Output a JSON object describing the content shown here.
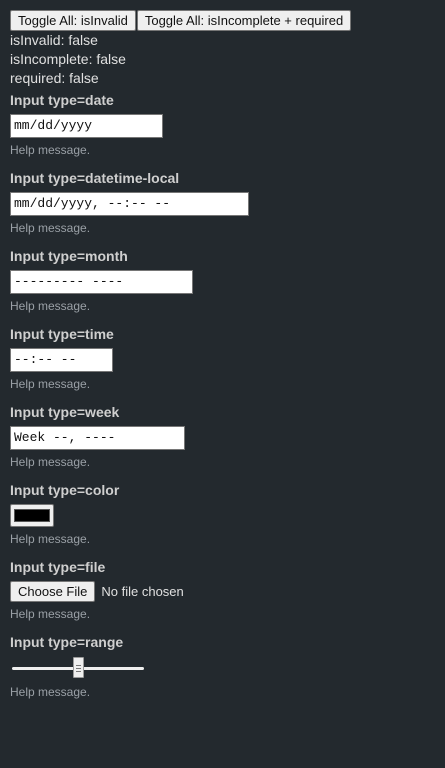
{
  "toolbar": {
    "toggle_invalid_label": "Toggle All: isInvalid",
    "toggle_incomplete_label": "Toggle All: isIncomplete + required"
  },
  "status": {
    "is_invalid": "isInvalid: false",
    "is_incomplete": "isIncomplete: false",
    "required": "required: false"
  },
  "help_text": "Help message.",
  "fields": {
    "date": {
      "label": "Input type=date",
      "display": "mm/dd/yyyy"
    },
    "datetime_local": {
      "label": "Input type=datetime-local",
      "display": "mm/dd/yyyy, --:-- --"
    },
    "month": {
      "label": "Input type=month",
      "display": "--------- ----"
    },
    "time": {
      "label": "Input type=time",
      "display": "--:-- --"
    },
    "week": {
      "label": "Input type=week",
      "display": "Week --, ----"
    },
    "color": {
      "label": "Input type=color",
      "value": "#000000"
    },
    "file": {
      "label": "Input type=file",
      "button": "Choose File",
      "status": "No file chosen"
    },
    "range": {
      "label": "Input type=range",
      "value_fraction": 0.5
    }
  }
}
